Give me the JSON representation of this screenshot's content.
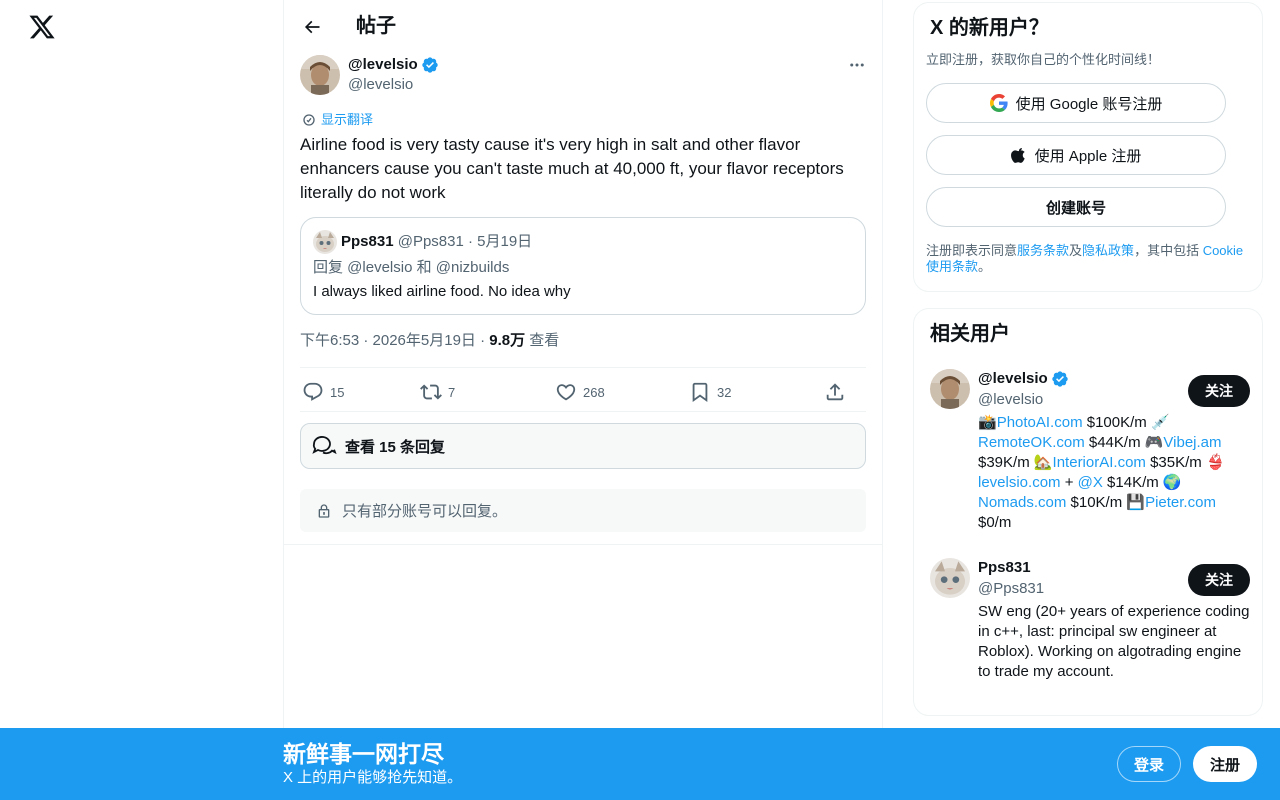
{
  "app": {
    "logo_icon": "x-logo-icon"
  },
  "header": {
    "title": "帖子"
  },
  "post": {
    "author_name": "@levelsio",
    "author_handle": "@levelsio",
    "translate_label": "显示翻译",
    "text": "Airline food is very tasty cause it's very high in salt and other flavor enhancers cause you can't taste much at 40,000 ft, your flavor receptors literally do not work",
    "quote": {
      "author_name": "Pps831",
      "meta": "@Pps831 · 5月19日",
      "reply_to": "回复 @levelsio 和 @nizbuilds",
      "text": "I always liked airline food. No idea why"
    },
    "timestamp": "下午6:53 · 2026年5月19日 · ",
    "views_count": "9.8万",
    "views_label": " 查看",
    "actions": {
      "replies": "15",
      "reposts": "7",
      "likes": "268",
      "bookmarks": "32"
    },
    "view_replies_label": "查看 15 条回复",
    "reply_restriction": "只有部分账号可以回复。"
  },
  "signup": {
    "title": "X 的新用户？",
    "subtitle": "立即注册，获取你自己的个性化时间线！",
    "google_label": "使用 Google 账号注册",
    "apple_label": "使用 Apple 注册",
    "create_label": "创建账号",
    "legal_prefix": "注册即表示同意",
    "legal_terms": "服务条款",
    "legal_and": "及",
    "legal_privacy": "隐私政策",
    "legal_mid": "，其中包括 ",
    "legal_cookie": "Cookie 使用条款",
    "legal_end": "。"
  },
  "related": {
    "title": "相关用户",
    "users": [
      {
        "name": "@levelsio",
        "handle": "@levelsio",
        "follow_label": "关注",
        "bio": [
          {
            "t": "📸",
            "link": false
          },
          {
            "t": "PhotoAI.com",
            "link": true
          },
          {
            "t": " $100K/m 💉 ",
            "link": false
          },
          {
            "t": "RemoteOK.com",
            "link": true
          },
          {
            "t": " $44K/m 🎮",
            "link": false
          },
          {
            "t": "Vibej.am",
            "link": true
          },
          {
            "t": " $39K/m 🏡",
            "link": false
          },
          {
            "t": "InteriorAI.com",
            "link": true
          },
          {
            "t": " $35K/m 👙 ",
            "link": false
          },
          {
            "t": "levelsio.com",
            "link": true
          },
          {
            "t": " + ",
            "link": false
          },
          {
            "t": "@X",
            "link": true
          },
          {
            "t": " $14K/m 🌍 ",
            "link": false
          },
          {
            "t": "Nomads.com",
            "link": true
          },
          {
            "t": " $10K/m 💾",
            "link": false
          },
          {
            "t": "Pieter.com",
            "link": true
          },
          {
            "t": " $0/m",
            "link": false
          }
        ]
      },
      {
        "name": "Pps831",
        "handle": "@Pps831",
        "follow_label": "关注",
        "bio_text": "SW eng (20+ years of experience coding in c++, last: principal sw engineer at Roblox). Working on algotrading engine to trade my account."
      }
    ]
  },
  "banner": {
    "title": "新鲜事一网打尽",
    "subtitle": "X 上的用户能够抢先知道。",
    "login_label": "登录",
    "signup_label": "注册"
  },
  "colors": {
    "accent": "#1d9bf0",
    "text": "#0f1419",
    "muted": "#536471",
    "border": "#cfd9de"
  }
}
